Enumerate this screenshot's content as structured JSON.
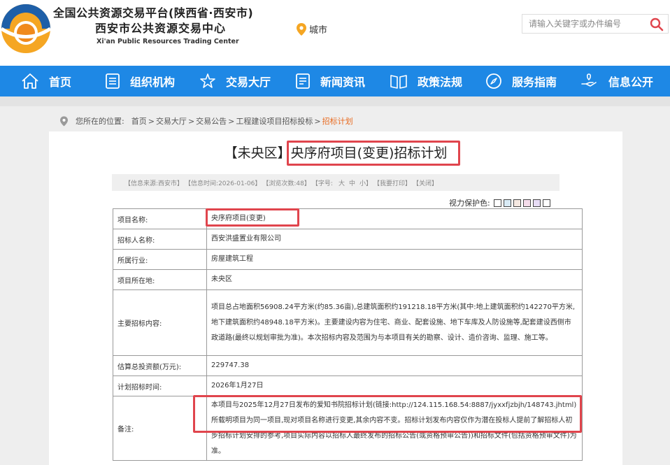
{
  "header": {
    "org_line1": "全国公共资源交易平台(陕西省·西安市)",
    "org_line2": "西安市公共资源交易中心",
    "org_line3": "Xi'an Public Resources Trading Center",
    "city_label": "城市",
    "search_placeholder": "请输入关键字或办件编号"
  },
  "nav": {
    "items": [
      {
        "label": "首页",
        "icon": "home-icon"
      },
      {
        "label": "组织机构",
        "icon": "document-icon"
      },
      {
        "label": "交易大厅",
        "icon": "star-icon"
      },
      {
        "label": "新闻资讯",
        "icon": "list-icon"
      },
      {
        "label": "政策法规",
        "icon": "book-icon"
      },
      {
        "label": "服务指南",
        "icon": "compass-icon"
      },
      {
        "label": "信息公开",
        "icon": "hand-icon"
      }
    ]
  },
  "breadcrumb": {
    "prefix": "您所在的位置:",
    "items": [
      "首页",
      "交易大厅",
      "交易公告",
      "工程建设项目招标投标",
      "招标计划"
    ]
  },
  "article": {
    "title": "【未央区】央序府项目(变更)招标计划",
    "meta": {
      "source": "【信息来源:西安市】",
      "time": "【信息时间:2026-01-06】",
      "views": "【浏览次数:48】",
      "font_size_prefix": "【字号:",
      "font_large": "大",
      "font_medium": "中",
      "font_small": "小】",
      "print": "【我要打印】",
      "close": "【关闭】"
    },
    "eye_care_label": "视力保护色:",
    "eye_colors": [
      "#ffffff",
      "#d8eaf5",
      "#f5e8e1",
      "#f5dcea",
      "#e7dcf5",
      "#ffffff"
    ]
  },
  "table": {
    "rows": [
      {
        "key": "项目名称:",
        "value": "央序府项目(变更)"
      },
      {
        "key": "招标人名称:",
        "value": "西安洪盛置业有限公司"
      },
      {
        "key": "所属行业:",
        "value": "房屋建筑工程"
      },
      {
        "key": "项目所在地:",
        "value": "未央区"
      },
      {
        "key": "主要招标内容:",
        "value": "项目总占地面积56908.24平方米(约85.36亩),总建筑面积约191218.18平方米(其中:地上建筑面积约142270平方米,地下建筑面积约48948.18平方米)。主要建设内容为住宅、商业、配套设施、地下车库及人防设施等,配套建设西侧市政道路(最终以规划审批为准)。本次招标内容及范围为与本项目有关的勘察、设计、造价咨询、监理、施工等。"
      },
      {
        "key": "估算总投资额(万元):",
        "value": "229747.38"
      },
      {
        "key": "计划招标时间:",
        "value": "2026年1月27日"
      },
      {
        "key": "备注:",
        "value": "本项目与2025年12月27日发布的爱知书院招标计划(链接:http://124.115.168.54:8887/jyxxfjzbjh/148743.jhtml)所载明项目为同一项目,现对项目名称进行变更,其余内容不变。招标计划发布内容仅作为潜在投标人提前了解招标人初步招标计划安排的参考,项目实际内容以招标人最终发布的招标公告(或资格预审公告))和招标文件(包括资格预审文件)为准。"
      }
    ]
  },
  "colors": {
    "nav_blue": "#1e88e5",
    "accent_orange": "#e86a1f",
    "highlight_red": "#e0454d"
  }
}
